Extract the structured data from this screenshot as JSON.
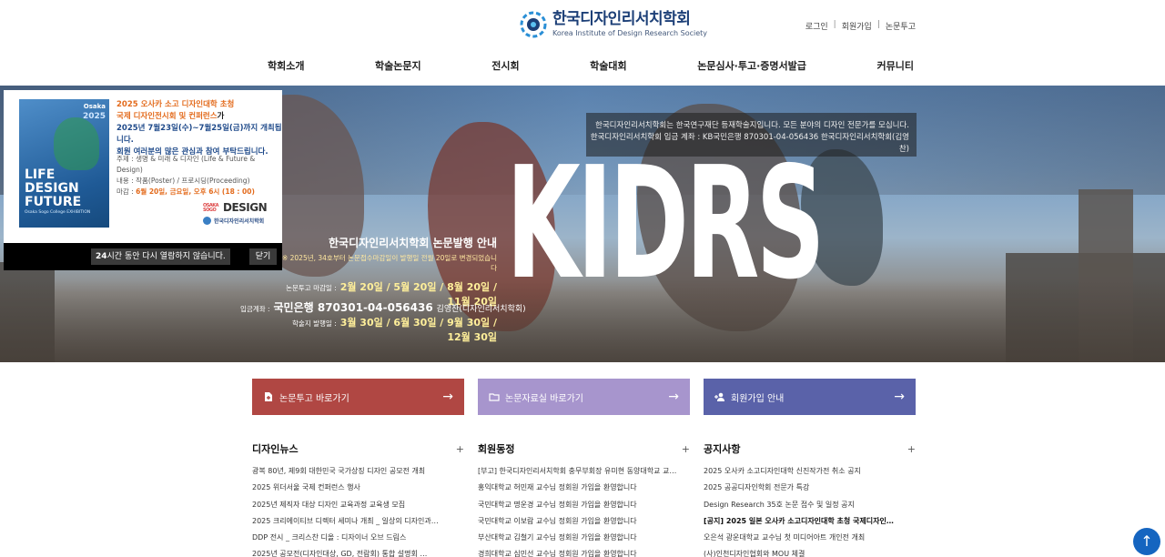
{
  "header": {
    "logo_title": "한국디자인리서치학회",
    "logo_subtitle": "Korea Institute of Design Research Society",
    "util_links": [
      "로그인",
      "회원가입",
      "논문투고"
    ],
    "nav": [
      "학회소개",
      "학술논문지",
      "전시회",
      "학술대회",
      "논문심사·투고·증명서발급",
      "커뮤니티"
    ]
  },
  "hero": {
    "big_title": "KIDRS",
    "notice_line1": "한국디자인리서치학회는 한국연구재단 등재학술지입니다. 모든 분야의 디자인 전문가를 모십니다.",
    "notice_line2": "한국디자인리서치학회 입금 계좌 : KB국민은행 870301-04-056436 한국디자인리서치학회(김영찬)",
    "pub_title": "한국디자인리서치학회 논문발행 안내",
    "pub_note": "※ 2025년, 34호부터 논문접수마감일이 발행일 전월 20일로 변경되었습니다",
    "submit_label": "논문투고 마감일 :",
    "submit_dates": "2월 20일 / 5월 20일 / 8월 20일 / 11월 20일",
    "issue_label": "학술지 발행일 :",
    "issue_dates": "3월 30일 / 6월 30일 / 9월 30일 / 12월 30일",
    "bank_label": "입금계좌 :",
    "bank_value": "국민은행 870301-04-056436",
    "bank_holder": "김영찬(디자인리서치학회)"
  },
  "popup": {
    "poster_city": "Osaka",
    "poster_year": "2025",
    "poster_line1": "LIFE",
    "poster_line2": "DESIGN",
    "poster_line3": "FUTURE",
    "poster_sub": "Osaka Sogo College EXHIBITION",
    "title_line1": "2025 오사카 소고 디자인대학 초청",
    "title_line2": "국제 디자인전시회 및 컨퍼런스",
    "title_line2_suffix": "가",
    "dates_line1": "2025년 7월23일(수)~7월25일(금)까지 개최됩니다.",
    "dates_line2": "회원 여러분의 많은 관심과 참여 부탁드립니다.",
    "theme": "주제 : 생명 & 미래 & 디자인 (Life & Future & Design)",
    "content": "내용 : 작품(Poster) / 프로시딩(Proceeding)",
    "deadline_label": "마감 :",
    "deadline_value": "6월 20일, 금요일, 오후 6시 (18 : 00)",
    "brand_small": "OSAKA SOGO",
    "brand": "DESIGN",
    "org": "한국디자인리서치학회",
    "dismiss_hours": "24",
    "dismiss_text": "시간 동안 다시 열람하지 않습니다.",
    "close": "닫기"
  },
  "quick": [
    {
      "label": "논문투고 바로가기",
      "icon": "file-plus-icon",
      "color": "#b04743"
    },
    {
      "label": "논문자료실 바로가기",
      "icon": "folder-icon",
      "color": "#a795cd"
    },
    {
      "label": "회원가입 안내",
      "icon": "user-add-icon",
      "color": "#5a62a9"
    }
  ],
  "boards": [
    {
      "title": "디자인뉴스",
      "items": [
        "광복 80년, 제9회 대한민국 국가상징 디자인 공모전 개최",
        "2025 위더서울 국제 컨퍼런스 행사",
        "2025년 제직자 대상 디자인 교육과정 교육생 모집",
        "2025 크리에이티브 디렉터 세미나 개최 _ 일상의 디자인과…",
        "DDP 전시 _ 크리스찬 디올 : 디자이너 오브 드림스",
        "2025년 공모전(디자인대상, GD, 전람회) 통합 설명회 …"
      ],
      "bold": []
    },
    {
      "title": "회원동정",
      "items": [
        "[부고] 한국디자인리서치학회 충무부회장 유미현 동양대학교 교…",
        "홍익대학교 허민재 교수님 정회원 가입을 환영합니다",
        "국민대학교 명운경 교수님 정회원 가입을 환영합니다",
        "국민대학교 이보람 교수님 정회원 가입을 환영합니다",
        "부산대학교 김철기 교수님 정회원 가입을 환영합니다",
        "경희대학교 심민선 교수님 정회원 가입을 환영합니다"
      ],
      "bold": []
    },
    {
      "title": "공지사항",
      "items": [
        "2025 오사카 소고디자인대학 신진작가전 취소 공지",
        "2025 공공디자인학회 전문가 특강",
        "Design Research 35호 논문 접수 및 일정 공지",
        "[공지] 2025 일본 오사카 소고디자인대학 초청 국제디자인…",
        "오은석 광운대학교 교수님 첫 미디어아트 개인전 개최",
        "(사)인천디자인협회와 MOU 체결"
      ],
      "bold": [
        3
      ]
    }
  ],
  "colors": {
    "brand_navy": "#1c3f77",
    "accent_orange": "#e36b1d",
    "top_button": "#1565c0"
  }
}
